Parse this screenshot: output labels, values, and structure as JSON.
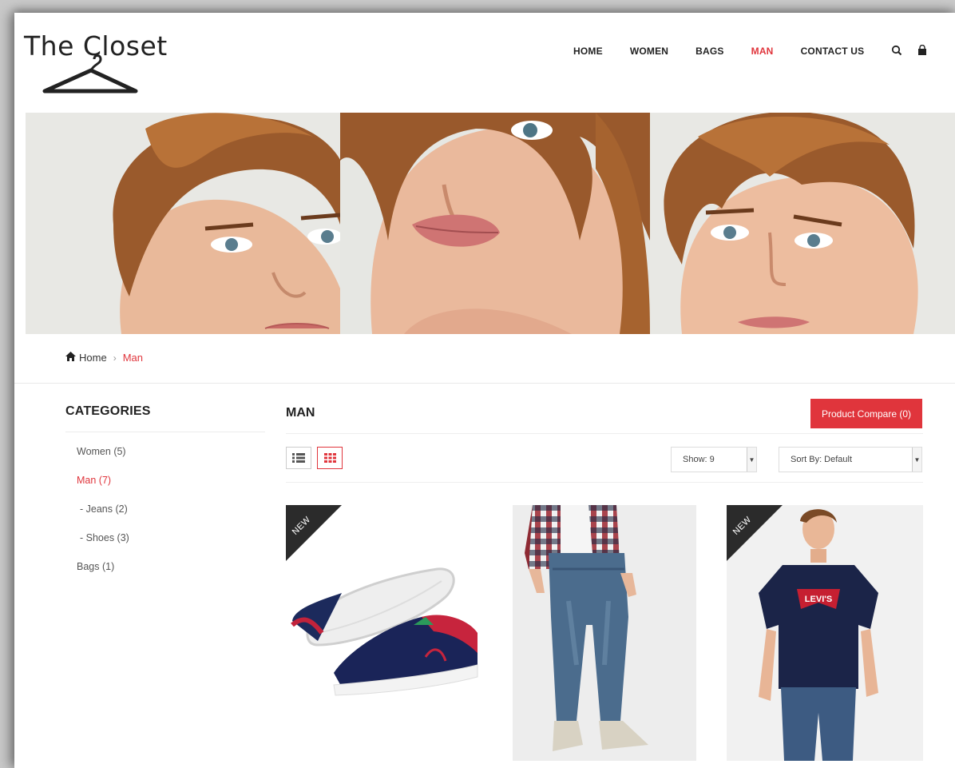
{
  "brand": {
    "name": "The Closet"
  },
  "nav": {
    "items": [
      {
        "label": "HOME",
        "active": false
      },
      {
        "label": "WOMEN",
        "active": false
      },
      {
        "label": "BAGS",
        "active": false
      },
      {
        "label": "MAN",
        "active": true
      },
      {
        "label": "CONTACT US",
        "active": false
      }
    ],
    "icons": [
      "search-icon",
      "shopping-bag-icon"
    ]
  },
  "breadcrumb": {
    "home": "Home",
    "current": "Man"
  },
  "sidebar": {
    "title": "CATEGORIES",
    "items": [
      {
        "label": "Women (5)",
        "level": 0,
        "active": false
      },
      {
        "label": "Man (7)",
        "level": 0,
        "active": true
      },
      {
        "label": "- Jeans (2)",
        "level": 1,
        "active": false
      },
      {
        "label": "- Shoes (3)",
        "level": 1,
        "active": false
      },
      {
        "label": "Bags (1)",
        "level": 0,
        "active": false
      }
    ]
  },
  "main": {
    "title": "MAN",
    "compare_label": "Product Compare (0)",
    "show_label": "Show: 9",
    "sort_label": "Sort By: Default",
    "view_modes": [
      "list-view-icon",
      "grid-view-icon"
    ]
  },
  "products": [
    {
      "badge": "NEW",
      "image": "sneakers-image"
    },
    {
      "badge": "",
      "image": "jeans-image"
    },
    {
      "badge": "NEW",
      "image": "tshirt-image"
    }
  ],
  "product_print": {
    "tshirt_logo": "LEVI'S"
  },
  "colors": {
    "accent": "#e0353c",
    "text": "#222222",
    "badge": "#2b2b2b"
  }
}
